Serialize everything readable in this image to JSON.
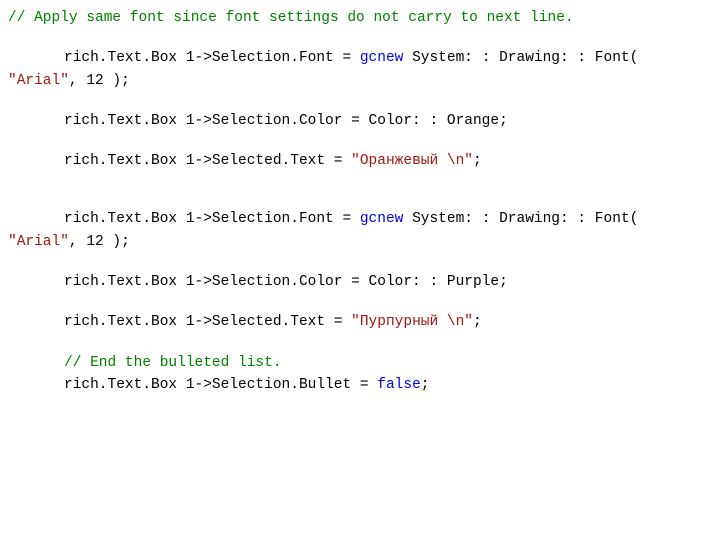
{
  "lines": {
    "comment1": "// Apply same font since font settings do not carry to next line.",
    "l2a": "rich.Text.Box 1->Selection.Font = ",
    "l2k": "gcnew",
    "l2b": " System: : Drawing: : Font( ",
    "l2s": "\"Arial\"",
    "l2c": ", 12 );",
    "l3a": "rich.Text.Box 1->Selection.Color = Color: : Orange;",
    "l4a": "rich.Text.Box 1->Selected.Text = ",
    "l4s": "\"Оранжевый \\n\"",
    "l4b": ";",
    "l5a": "rich.Text.Box 1->Selection.Font = ",
    "l5k": "gcnew",
    "l5b": " System: : Drawing: : Font( ",
    "l5s": "\"Arial\"",
    "l5c": ", 12 );",
    "l6a": "rich.Text.Box 1->Selection.Color = Color: : Purple;",
    "l7a": "rich.Text.Box 1->Selected.Text = ",
    "l7s": "\"Пурпурный \\n\"",
    "l7b": ";",
    "comment2": "// End the bulleted list.",
    "l8a": "rich.Text.Box 1->Selection.Bullet = ",
    "l8k": "false",
    "l8b": ";"
  }
}
